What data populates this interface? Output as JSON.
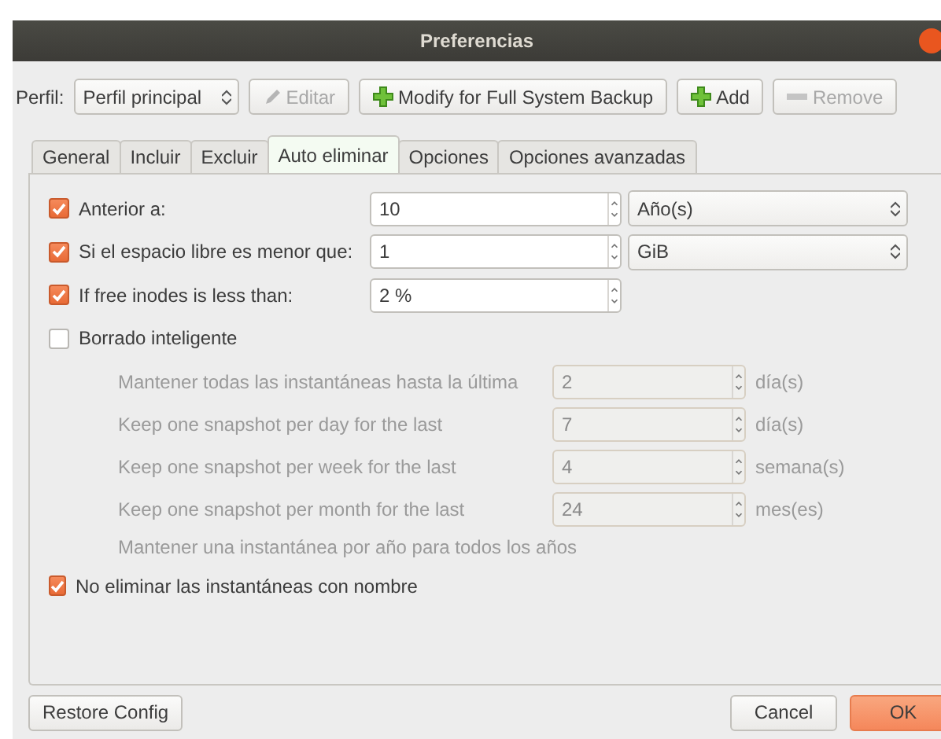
{
  "window": {
    "title": "Preferencias"
  },
  "profile": {
    "label": "Perfil:",
    "value": "Perfil principal"
  },
  "toolbar": [
    {
      "label": "Editar",
      "disabled": true
    },
    {
      "label": "Modify for Full System Backup",
      "disabled": false
    },
    {
      "label": "Add",
      "disabled": false
    },
    {
      "label": "Remove",
      "disabled": true
    }
  ],
  "tabs": [
    {
      "label": "General",
      "selected": false
    },
    {
      "label": "Incluir",
      "selected": false
    },
    {
      "label": "Excluir",
      "selected": false
    },
    {
      "label": "Auto eliminar",
      "selected": true
    },
    {
      "label": "Opciones",
      "selected": false
    },
    {
      "label": "Opciones avanzadas",
      "selected": false
    }
  ],
  "rows": [
    {
      "kind": "check",
      "label": "Anterior a:",
      "checked": true,
      "value": "10",
      "unit_combo": "Año(s)"
    },
    {
      "kind": "check",
      "label": "Si el espacio libre es menor que:",
      "checked": true,
      "value": "1",
      "unit_combo": "GiB"
    },
    {
      "kind": "check",
      "label": "If free inodes is less than:",
      "checked": true,
      "value": "2 %"
    },
    {
      "kind": "check",
      "label": "Borrado inteligente",
      "checked": false
    },
    {
      "kind": "sub",
      "label": "Mantener todas las instantáneas hasta la última",
      "value": "2",
      "unit": "día(s)",
      "disabled": true
    },
    {
      "kind": "sub",
      "label": "Keep one snapshot per day for the last",
      "value": "7",
      "unit": "día(s)",
      "disabled": true
    },
    {
      "kind": "sub",
      "label": "Keep one snapshot per week for the last",
      "value": "4",
      "unit": "semana(s)",
      "disabled": true
    },
    {
      "kind": "sub",
      "label": "Keep one snapshot per month for the last",
      "value": "24",
      "unit": "mes(es)",
      "disabled": true
    },
    {
      "kind": "note",
      "label": "Mantener una instantánea por año para todos los años",
      "disabled": true
    },
    {
      "kind": "check",
      "label": "No eliminar las instantáneas con nombre",
      "checked": true
    }
  ],
  "footer": {
    "restore": "Restore Config",
    "cancel": "Cancel",
    "ok": "OK"
  }
}
